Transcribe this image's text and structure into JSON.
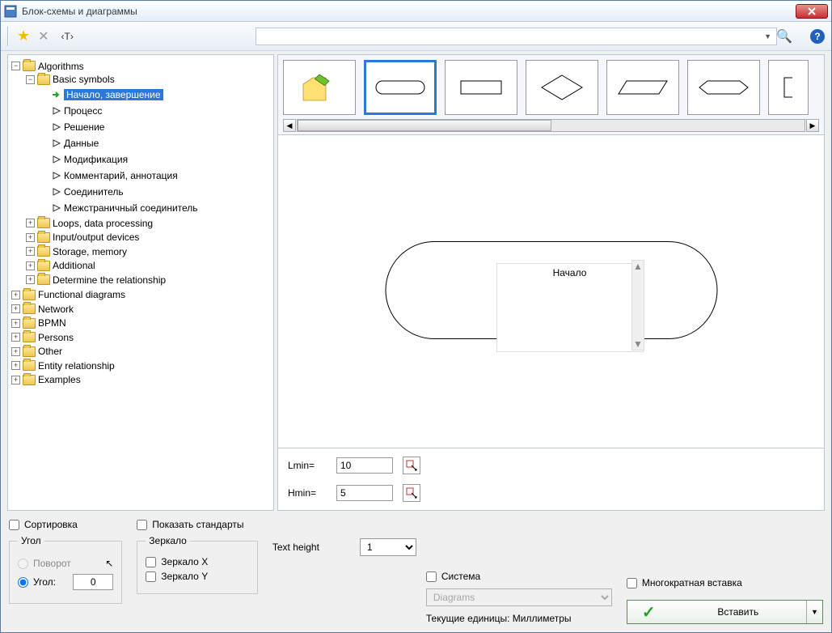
{
  "window": {
    "title": "Блок-схемы и диаграммы"
  },
  "toolbar": {
    "text_mode": "‹T›"
  },
  "tree": {
    "root": "Algorithms",
    "basic": "Basic symbols",
    "items": [
      "Начало, завершение",
      "Процесс",
      "Решение",
      "Данные",
      "Модификация",
      "Комментарий, аннотация",
      "Соединитель",
      "Межстраничный соединитель"
    ],
    "loops": "Loops, data processing",
    "io": "Input/output devices",
    "storage": "Storage, memory",
    "additional": "Additional",
    "determine": "Determine the relationship",
    "functional": "Functional diagrams",
    "network": "Network",
    "bpmn": "BPMN",
    "persons": "Persons",
    "other": "Other",
    "er": "Entity relationship",
    "examples": "Examples"
  },
  "preview": {
    "label": "Начало"
  },
  "params": {
    "lmin_label": "Lmin=",
    "lmin": "10",
    "hmin_label": "Hmin=",
    "hmin": "5"
  },
  "footer": {
    "sort": "Сортировка",
    "standards": "Показать стандарты",
    "angle_group": "Угол",
    "rotate": "Поворот",
    "angle": "Угол:",
    "angle_val": "0",
    "mirror_group": "Зеркало",
    "mirror_x": "Зеркало X",
    "mirror_y": "Зеркало Y",
    "text_height": "Text height",
    "text_height_val": "1",
    "system": "Система",
    "system_val": "Diagrams",
    "units": "Текущие единицы: Миллиметры",
    "multi": "Многократная вставка",
    "insert": "Вставить"
  }
}
